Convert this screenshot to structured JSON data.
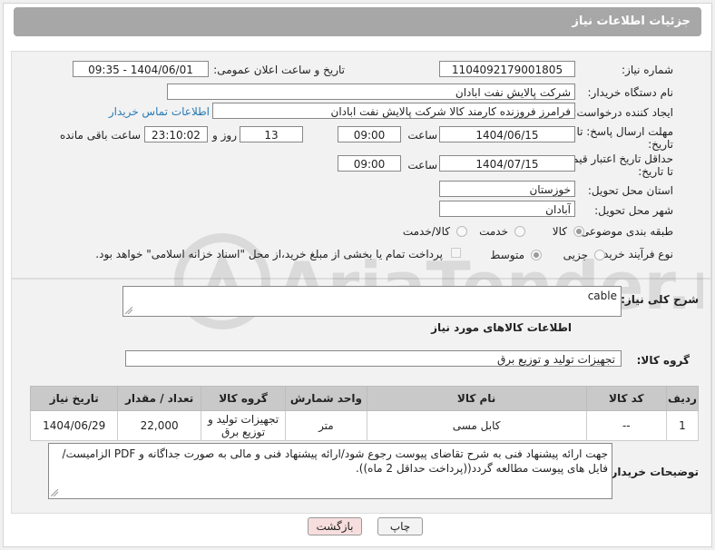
{
  "header": {
    "title": "جزئیات اطلاعات نیاز"
  },
  "form": {
    "need_number_label": "شماره نیاز:",
    "need_number": "1104092179001805",
    "announce_label": "تاریخ و ساعت اعلان عمومی:",
    "announce_value": "1404/06/01 - 09:35",
    "buyer_org_label": "نام دستگاه خریدار:",
    "buyer_org": "شرکت پالایش نفت ابادان",
    "creator_label": "ایجاد کننده درخواست:",
    "creator": "فرامرز فروزنده کارمند کالا شرکت پالایش نفت ابادان",
    "contact_link": "اطلاعات تماس خریدار",
    "deadline_label_1": "مهلت ارسال پاسخ: تا",
    "deadline_label_2": "تاریخ:",
    "deadline_date": "1404/06/15",
    "time_label": "ساعت",
    "deadline_time": "09:00",
    "days_value": "13",
    "days_label": "روز و",
    "remaining_time": "23:10:02",
    "remaining_label": "ساعت باقی مانده",
    "price_label_1": "حداقل تاریخ اعتبار قیمت:",
    "price_label_2": "تا تاریخ:",
    "price_date": "1404/07/15",
    "price_time": "09:00",
    "province_label": "استان محل تحویل:",
    "province": "خوزستان",
    "city_label": "شهر محل تحویل:",
    "city": "آبادان",
    "category_label": "طبقه بندی موضوعی:",
    "category_options": [
      "کالا",
      "خدمت",
      "کالا/خدمت"
    ],
    "process_label": "نوع فرآیند خرید :",
    "process_options": [
      "جزیی",
      "متوسط"
    ],
    "payment_note": "پرداخت تمام یا بخشی از مبلغ خرید،از محل \"اسناد خزانه اسلامی\" خواهد بود."
  },
  "details": {
    "summary_label": "شرح کلی نیاز:",
    "summary": "cable",
    "items_title": "اطلاعات کالاهای مورد نیاز",
    "group_label": "گروه کالا:",
    "group_value": "تجهیزات تولید و توزیع برق",
    "table": {
      "headers": [
        "ردیف",
        "کد کالا",
        "نام کالا",
        "واحد شمارش",
        "گروه کالا",
        "تعداد / مقدار",
        "تاریخ نیاز"
      ],
      "rows": [
        [
          "1",
          "--",
          "کابل مسی",
          "متر",
          "تجهیزات تولید و توزیع برق",
          "22,000",
          "1404/06/29"
        ]
      ]
    },
    "buyer_notes_label": "توضیحات خریدار:",
    "buyer_notes": "جهت ارائه پیشنهاد فنی به شرح تقاضای پیوست رجوع شود/ارائه پیشنهاد فنی و مالی به صورت جداگانه و PDF الزامیست/فایل های پیوست مطالعه گردد((پرداخت حداقل 2 ماه))."
  },
  "buttons": {
    "print": "چاپ",
    "back": "بازگشت"
  },
  "watermark": "AriaTender.neT",
  "colors": {
    "header": "#a7a7a7",
    "link": "#2a7ab5",
    "back_button": "#f7dede",
    "table_header": "#c9c9c9"
  }
}
